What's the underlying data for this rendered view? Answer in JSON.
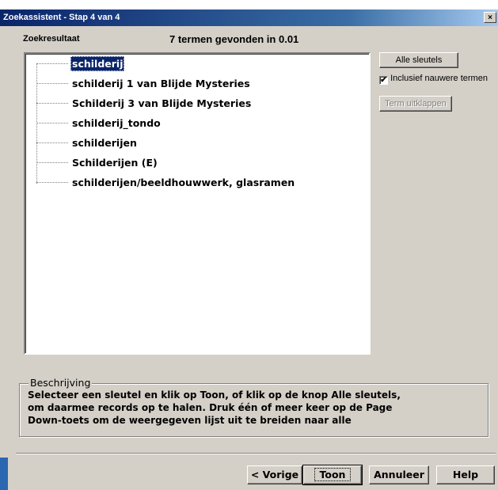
{
  "window": {
    "title": "Zoekassistent - Stap 4 van 4",
    "close_glyph": "×"
  },
  "header": {
    "result_label": "Zoekresultaat",
    "found_text": "7 termen gevonden in 0.01"
  },
  "tree": {
    "items": [
      {
        "label": "schilderij",
        "selected": true
      },
      {
        "label": "schilderij 1 van Blijde Mysteries",
        "selected": false
      },
      {
        "label": "Schilderij 3 van Blijde Mysteries",
        "selected": false
      },
      {
        "label": "schilderij_tondo",
        "selected": false
      },
      {
        "label": "schilderijen",
        "selected": false
      },
      {
        "label": "Schilderijen (E)",
        "selected": false
      },
      {
        "label": "schilderijen/beeldhouwwerk, glasramen",
        "selected": false
      }
    ]
  },
  "side": {
    "all_keys_label": "Alle sleutels",
    "include_newer_label": "Inclusief nauwere termen",
    "include_newer_checked": true,
    "expand_term_label": "Term uitklappen"
  },
  "description": {
    "title": "Beschrijving",
    "lines": [
      "Selecteer een sleutel en klik op Toon, of klik op de knop Alle sleutels,",
      "om daarmee records op te halen. Druk één of meer keer op de Page",
      "Down-toets om de weergegeven lijst uit te breiden naar alle"
    ]
  },
  "footer": {
    "prev_label": "< Vorige",
    "show_label": "Toon",
    "cancel_label": "Annuleer",
    "help_label": "Help"
  },
  "colors": {
    "titlebar": "#0a246a",
    "selection": "#0a246a",
    "face": "#d4d0c8"
  }
}
